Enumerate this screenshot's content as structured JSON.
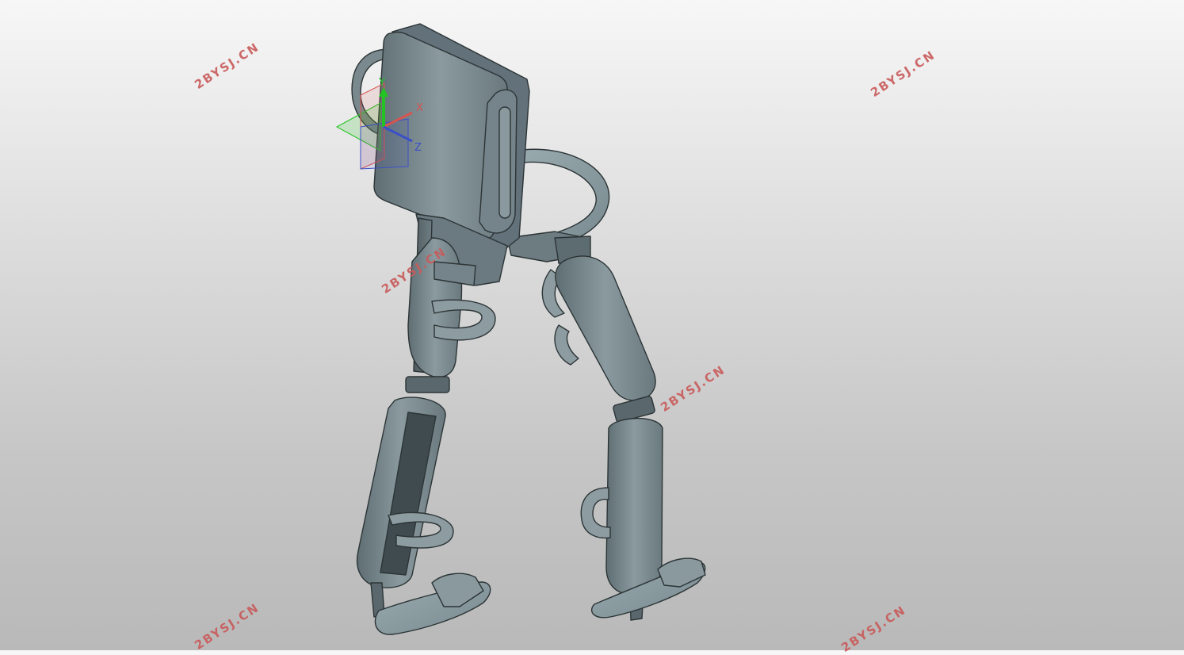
{
  "viewport": {
    "model": "exoskeleton",
    "shade_color": "#7e8d92",
    "edge_color": "#2c3436"
  },
  "triad": {
    "x_label": "X",
    "y_label": "Y",
    "z_label": "Z",
    "x_color": "#d9534f",
    "y_color": "#22c322",
    "z_color": "#3b4fc8"
  },
  "watermarks": [
    "2BYSJ.CN",
    "2BYSJ.CN",
    "2BYSJ.CN",
    "2BYSJ.CN",
    "2BYSJ.CN",
    "2BYSJ.CN"
  ]
}
